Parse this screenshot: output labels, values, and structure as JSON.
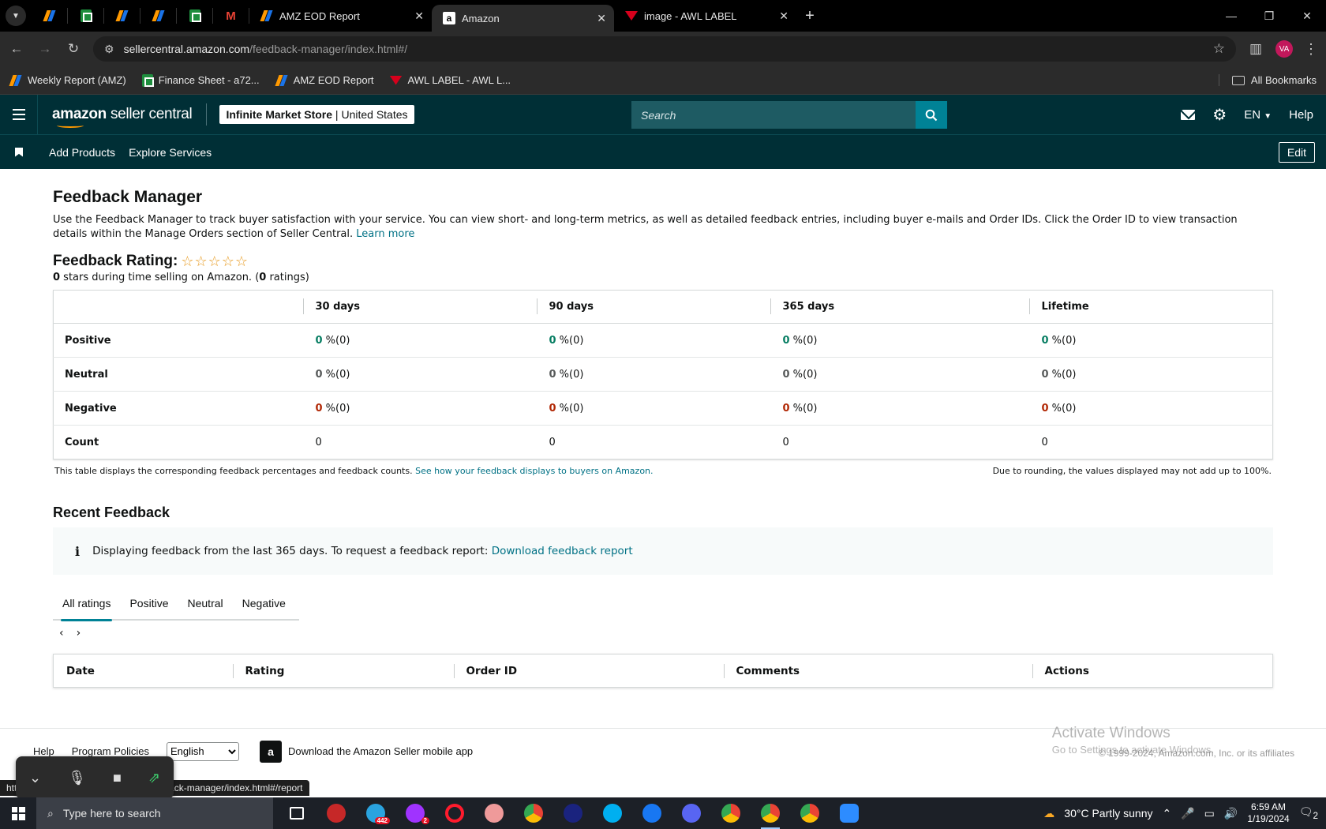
{
  "browser": {
    "tabs": [
      {
        "title": "AMZ EOD Report",
        "icon": "amz-report-icon"
      },
      {
        "title": "Amazon",
        "icon": "amazon-a-icon"
      },
      {
        "title": "image - AWL LABEL",
        "icon": "awl-icon"
      }
    ],
    "url_host": "sellercentral.amazon.com",
    "url_path": "/feedback-manager/index.html#/",
    "avatar_initials": "VA",
    "bookmarks": [
      "Weekly Report (AMZ)",
      "Finance Sheet - a72...",
      "AMZ EOD Report",
      "AWL LABEL - AWL L..."
    ],
    "all_bookmarks": "All Bookmarks"
  },
  "header": {
    "logo_brand": "amazon",
    "logo_rest": "seller central",
    "store_name": "Infinite Market Store",
    "store_region": "United States",
    "search_placeholder": "Search",
    "language": "EN",
    "help": "Help"
  },
  "subnav": {
    "links": [
      "Add Products",
      "Explore Services"
    ],
    "edit": "Edit"
  },
  "feedback": {
    "title": "Feedback Manager",
    "description": "Use the Feedback Manager to track buyer satisfaction with your service. You can view short- and long-term metrics, as well as detailed feedback entries, including buyer e-mails and Order IDs. Click the Order ID to view transaction details within the Manage Orders section of Seller Central.",
    "learn_more": "Learn more",
    "rating_label": "Feedback Rating:",
    "stars_display": "☆☆☆☆☆",
    "star_count": "0",
    "stars_text_1": " stars during time selling on Amazon. (",
    "rating_count": "0",
    "stars_text_2": " ratings)"
  },
  "metrics": {
    "columns": [
      "30 days",
      "90 days",
      "365 days",
      "Lifetime"
    ],
    "rows": [
      {
        "label": "Positive",
        "type": "pos",
        "cells": [
          [
            "0",
            " %(0)"
          ],
          [
            "0",
            " %(0)"
          ],
          [
            "0",
            " %(0)"
          ],
          [
            "0",
            " %(0)"
          ]
        ]
      },
      {
        "label": "Neutral",
        "type": "neu",
        "cells": [
          [
            "0",
            " %(0)"
          ],
          [
            "0",
            " %(0)"
          ],
          [
            "0",
            " %(0)"
          ],
          [
            "0",
            " %(0)"
          ]
        ]
      },
      {
        "label": "Negative",
        "type": "neg",
        "cells": [
          [
            "0",
            " %(0)"
          ],
          [
            "0",
            " %(0)"
          ],
          [
            "0",
            " %(0)"
          ],
          [
            "0",
            " %(0)"
          ]
        ]
      },
      {
        "label": "Count",
        "type": "count",
        "cells": [
          [
            "0",
            ""
          ],
          [
            "0",
            ""
          ],
          [
            "0",
            ""
          ],
          [
            "0",
            ""
          ]
        ]
      }
    ],
    "note_left": "This table displays the corresponding feedback percentages and feedback counts.",
    "note_link": "See how your feedback displays to buyers on Amazon.",
    "note_right": "Due to rounding, the values displayed may not add up to 100%."
  },
  "recent": {
    "title": "Recent Feedback",
    "info_text": "Displaying feedback from the last 365 days. To request a feedback report:",
    "info_link": "Download feedback report",
    "tabs": [
      "All ratings",
      "Positive",
      "Neutral",
      "Negative"
    ],
    "active_tab": "All ratings",
    "columns": [
      "Date",
      "Rating",
      "Order ID",
      "Comments",
      "Actions"
    ]
  },
  "footer": {
    "help": "Help",
    "policies": "Program Policies",
    "language": "English",
    "app_download": "Download the Amazon Seller mobile app",
    "copyright": "© 1999-2024, Amazon.com, Inc. or its affiliates"
  },
  "watermark": {
    "line1": "Activate Windows",
    "line2": "Go to Settings to activate Windows."
  },
  "status_url": "https://sellercentral.amazon.com/feedback-manager/index.html#/report",
  "taskbar": {
    "search_placeholder": "Type here to search",
    "telegram_badge": "442",
    "messenger_badge": "2",
    "weather": "30°C  Partly sunny",
    "time": "6:59 AM",
    "date": "1/19/2024",
    "notifications": "2"
  },
  "colors": {
    "header_bg": "#002f36",
    "link": "#007185",
    "positive": "#067d62",
    "negative": "#b12704",
    "star": "#e79a1f"
  }
}
